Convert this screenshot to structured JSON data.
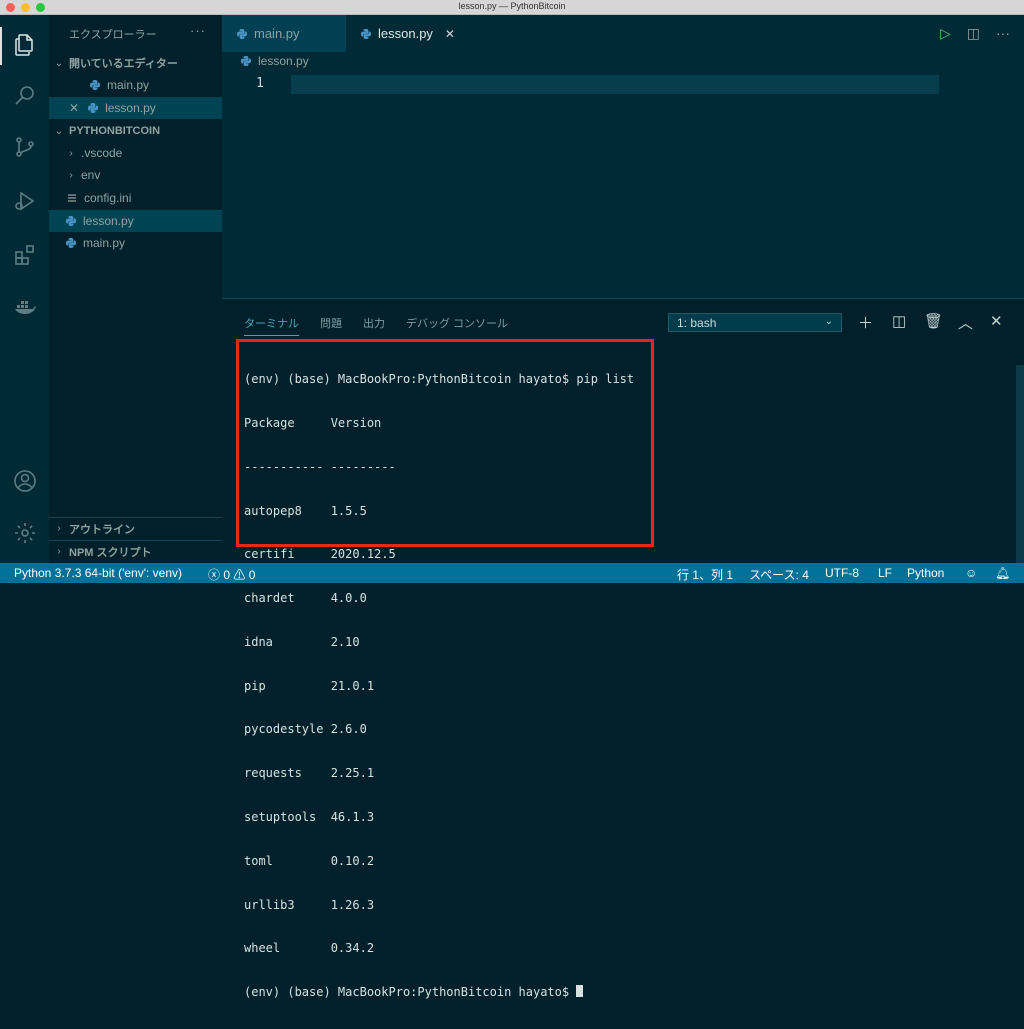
{
  "window": {
    "title": "lesson.py — PythonBitcoin"
  },
  "activity_bar": {
    "items": [
      "explorer-icon",
      "search-icon",
      "source-control-icon",
      "run-debug-icon",
      "extensions-icon",
      "docker-icon",
      "account-icon",
      "settings-gear-icon"
    ]
  },
  "sidebar": {
    "title": "エクスプローラー",
    "more": "···",
    "open_editors_label": "開いているエディター",
    "open_editors": [
      {
        "name": "main.py"
      },
      {
        "name": "lesson.py"
      }
    ],
    "project_label": "PYTHONBITCOIN",
    "tree": [
      {
        "name": ".vscode",
        "kind": "folder"
      },
      {
        "name": "env",
        "kind": "folder"
      },
      {
        "name": "config.ini",
        "kind": "file"
      },
      {
        "name": "lesson.py",
        "kind": "python"
      },
      {
        "name": "main.py",
        "kind": "python"
      }
    ],
    "outline_label": "アウトライン",
    "npm_label": "NPM スクリプト"
  },
  "tabs": [
    {
      "label": "main.py",
      "active": false
    },
    {
      "label": "lesson.py",
      "active": true
    }
  ],
  "breadcrumb": {
    "file": "lesson.py"
  },
  "editor": {
    "line_number": "1"
  },
  "panel": {
    "tabs": [
      "ターミナル",
      "問題",
      "出力",
      "デバッグ コンソール"
    ],
    "terminal_select": "1: bash",
    "terminal_lines": [
      "(env) (base) MacBookPro:PythonBitcoin hayato$ pip list",
      "Package     Version",
      "----------- ---------",
      "autopep8    1.5.5",
      "certifi     2020.12.5",
      "chardet     4.0.0",
      "idna        2.10",
      "pip         21.0.1",
      "pycodestyle 2.6.0",
      "requests    2.25.1",
      "setuptools  46.1.3",
      "toml        0.10.2",
      "urllib3     1.26.3",
      "wheel       0.34.2"
    ],
    "prompt": "(env) (base) MacBookPro:PythonBitcoin hayato$ "
  },
  "status_bar": {
    "interpreter": "Python 3.7.3 64-bit ('env': venv)",
    "errors": "0",
    "warnings": "0",
    "position": "行 1、列 1",
    "spaces": "スペース: 4",
    "encoding": "UTF-8",
    "eol": "LF",
    "language": "Python"
  },
  "colors": {
    "accent": "#00729a",
    "highlight": "#e8261b",
    "background": "#00212b"
  }
}
